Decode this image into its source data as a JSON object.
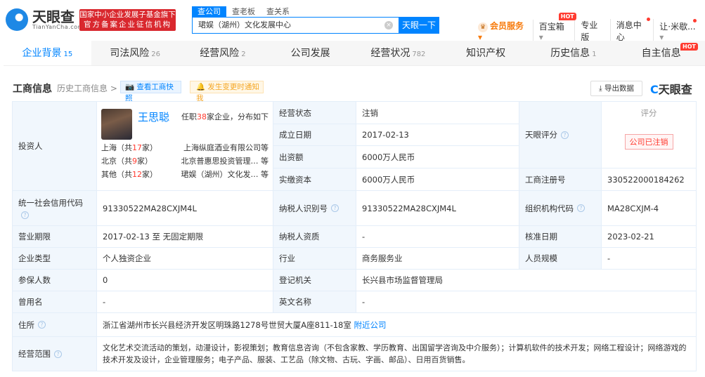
{
  "header": {
    "logo": "天眼查",
    "logo_sub": "TianYanCha.com",
    "badge_line1": "国家中小企业发展子基金旗下",
    "badge_line2": "官方备案企业征信机构",
    "search_tabs": [
      "查公司",
      "查老板",
      "查关系"
    ],
    "search_value": "珺娱（湖州）文化发展中心",
    "search_button": "天眼一下",
    "nav": {
      "vip": "会员服务",
      "treasure": "百宝箱",
      "hot": "HOT",
      "pro": "专业版",
      "messages": "消息中心",
      "user": "让·米歇..."
    }
  },
  "tabs": [
    {
      "label": "企业背景",
      "count": "15"
    },
    {
      "label": "司法风险",
      "count": "26"
    },
    {
      "label": "经营风险",
      "count": "2"
    },
    {
      "label": "公司发展",
      "count": ""
    },
    {
      "label": "经营状况",
      "count": "782"
    },
    {
      "label": "知识产权",
      "count": ""
    },
    {
      "label": "历史信息",
      "count": "1"
    },
    {
      "label": "自主信息",
      "count": "",
      "hot": "HOT"
    }
  ],
  "section": {
    "title": "工商信息",
    "history": "历史工商信息 >",
    "snapshot": "查看工商快照",
    "notify": "发生变更时通知我",
    "export": "导出数据",
    "brand": "天眼查"
  },
  "investor": {
    "label": "投资人",
    "name": "王思聪",
    "summary_pre": "任职",
    "summary_count": "38",
    "summary_post": "家企业，分布如下",
    "regions": [
      {
        "region": "上海（共",
        "count": "17",
        "suffix": "家）",
        "company": "上海纵庭酒业有限公司等"
      },
      {
        "region": "北京（共",
        "count": "9",
        "suffix": "家）",
        "company": "北京普惠思投资管理… 等"
      },
      {
        "region": "其他（共",
        "count": "12",
        "suffix": "家）",
        "company": "珺娱（湖州）文化发… 等"
      }
    ]
  },
  "fields": {
    "status_l": "经营状态",
    "status": "注销",
    "founded_l": "成立日期",
    "founded": "2017-02-13",
    "capital_l": "出资额",
    "capital": "6000万人民币",
    "paid_l": "实缴资本",
    "paid": "6000万人民币",
    "score_l": "天眼评分",
    "score_title": "评分",
    "score_stamp": "公司已注销",
    "regno_l": "工商注册号",
    "regno": "330522000184262",
    "credit_l": "统一社会信用代码",
    "credit": "91330522MA28CXJM4L",
    "taxid_l": "纳税人识别号",
    "taxid": "91330522MA28CXJM4L",
    "org_l": "组织机构代码",
    "org": "MA28CXJM-4",
    "term_l": "营业期限",
    "term": "2017-02-13 至 无固定期限",
    "taxq_l": "纳税人资质",
    "taxq": "-",
    "approve_l": "核准日期",
    "approve": "2023-02-21",
    "type_l": "企业类型",
    "type": "个人独资企业",
    "industry_l": "行业",
    "industry": "商务服务业",
    "staff_l": "人员规模",
    "staff": "-",
    "insured_l": "参保人数",
    "insured": "0",
    "authority_l": "登记机关",
    "authority": "长兴县市场监督管理局",
    "former_l": "曾用名",
    "former": "-",
    "en_l": "英文名称",
    "en": "-",
    "address_l": "住所",
    "address": "浙江省湖州市长兴县经济开发区明珠路1278号世贸大厦A座811-18室",
    "nearby": "附近公司",
    "scope_l": "经营范围",
    "scope": "文化艺术交流活动的策划，动漫设计，影视策划；教育信息咨询（不包含家教、学历教育、出国留学咨询及中介服务）；计算机软件的技术开发；网络工程设计；网络游戏的技术开发及设计，企业管理服务；电子产品、服装、工艺品（除文物、古玩、字画、邮品）、日用百货销售。"
  }
}
